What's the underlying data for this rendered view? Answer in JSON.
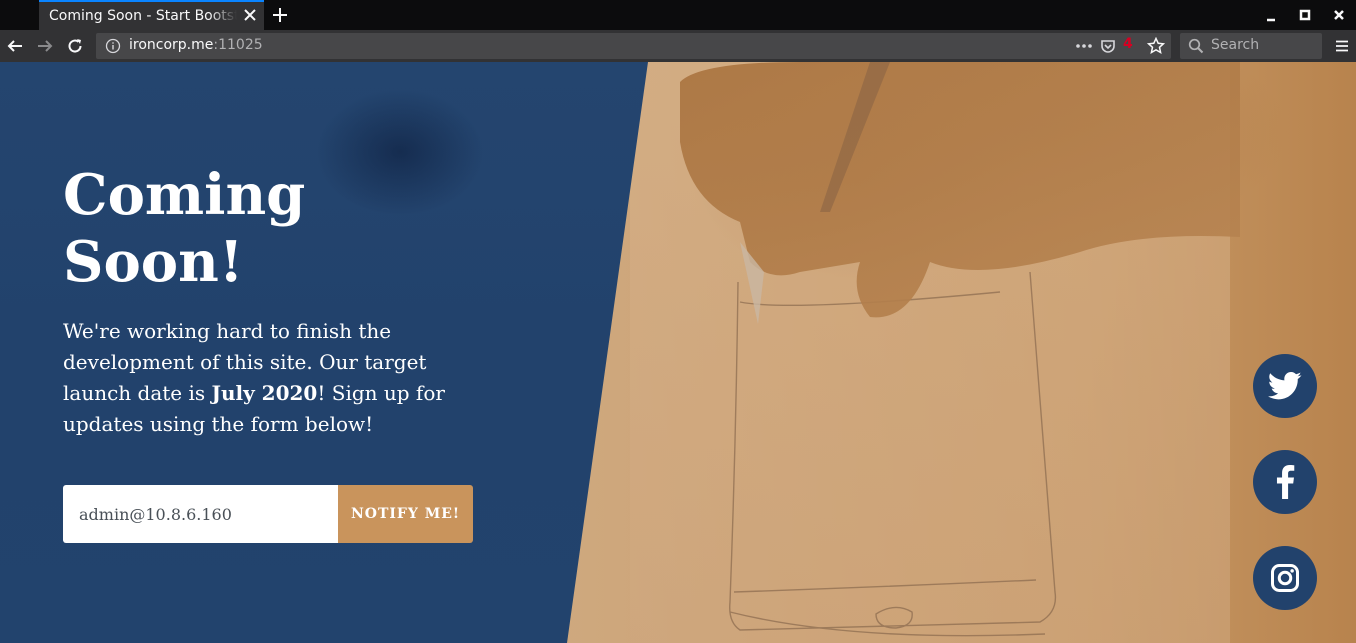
{
  "browser": {
    "tab_title": "Coming Soon - Start Bootstrap Theme",
    "url_host": "ironcorp.me",
    "url_port": ":11025",
    "pocket_count": "4",
    "search_placeholder": "Search",
    "icons": [
      "back-icon",
      "forward-icon",
      "reload-icon",
      "info-icon",
      "page-actions-icon",
      "pocket-icon",
      "bookmark-star-icon",
      "search-icon",
      "menu-icon",
      "close-icon",
      "new-tab-icon",
      "minimize-icon",
      "maximize-icon",
      "window-close-icon"
    ]
  },
  "hero": {
    "heading_line1": "Coming",
    "heading_line2": "Soon!",
    "lead_part1": "We're working hard to finish the development of this site. Our target launch date is ",
    "lead_bold": "July 2020",
    "lead_part2": "! Sign up for updates using the form below!"
  },
  "signup": {
    "email_value": "admin@10.8.6.160",
    "button_label": "NOTIFY ME!"
  },
  "social": {
    "items": [
      "twitter-icon",
      "facebook-icon",
      "instagram-icon"
    ]
  },
  "colors": {
    "primary_overlay": "#22426c",
    "accent": "#c9945c",
    "tab_highlight": "#0a84ff"
  }
}
